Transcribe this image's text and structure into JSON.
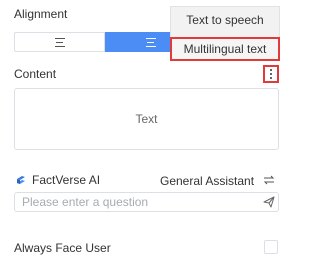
{
  "alignment": {
    "label": "Alignment",
    "options": [
      "align-left",
      "align-center"
    ],
    "selected": "align-center"
  },
  "menu": {
    "items": [
      "Text to speech",
      "Multilingual text"
    ],
    "highlighted": "Multilingual text"
  },
  "content": {
    "label": "Content",
    "text": "Text",
    "more_icon": "more-vertical-icon"
  },
  "ai": {
    "brand": "FactVerse AI",
    "brand_icon": "factverse-logo-icon",
    "assistant": "General Assistant",
    "swap_icon": "swap-icon",
    "input_placeholder": "Please enter a question",
    "input_value": "",
    "send_icon": "send-icon"
  },
  "always_face_user": {
    "label": "Always Face User",
    "checked": false
  },
  "colors": {
    "accent": "#4b8cf5",
    "highlight": "#e03a3a",
    "border": "#dcdfe6",
    "placeholder": "#a8abb2"
  }
}
